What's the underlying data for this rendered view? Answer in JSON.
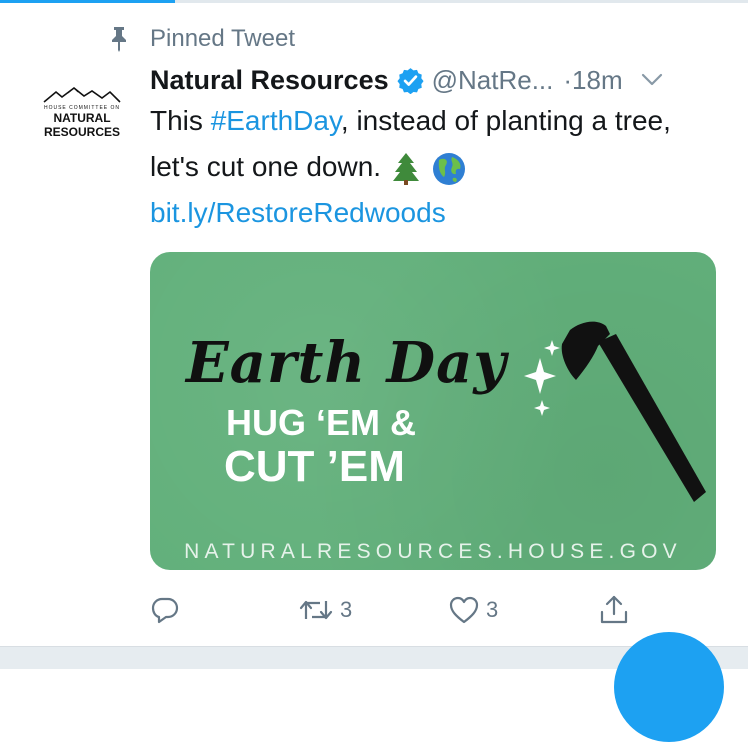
{
  "pinned": {
    "label": "Pinned Tweet",
    "icon": "pin-icon"
  },
  "account": {
    "avatar_small_text": "HOUSE COMMITTEE ON",
    "avatar_big_text_1": "NATURAL",
    "avatar_big_text_2": "RESOURCES",
    "display_name": "Natural Resources",
    "handle": "@NatRe...",
    "time": "·18m",
    "verified_icon": "verified-badge-icon"
  },
  "tweet": {
    "text_1": "This ",
    "hashtag": "#EarthDay",
    "text_2": ", instead of planting a tree, let's cut one down.",
    "link": "bit.ly/RestoreRedwoods",
    "emojis": [
      "evergreen-tree-emoji",
      "globe-emoji"
    ]
  },
  "card": {
    "headline": "Earth Day",
    "line1": "HUG ‘EM &",
    "line2": "CUT ’EM",
    "site": "NATURALRESOURCES.HOUSE.GOV",
    "background_color": "#62b07b"
  },
  "actions": {
    "reply_icon": "reply-icon",
    "retweet_icon": "retweet-icon",
    "retweet_count": "3",
    "like_icon": "heart-icon",
    "like_count": "3",
    "share_icon": "share-icon"
  },
  "colors": {
    "accent": "#1da1f2",
    "link": "#1b95e0",
    "muted": "#657786"
  }
}
